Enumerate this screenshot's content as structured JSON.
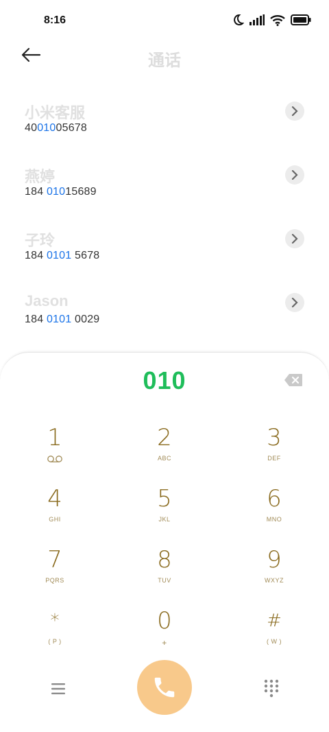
{
  "status_bar": {
    "time": "8:16",
    "icons": [
      "moon-icon",
      "signal-icon",
      "wifi-icon",
      "battery-icon"
    ]
  },
  "header": {
    "title": "通话",
    "back_icon": "arrow-left-icon"
  },
  "contacts": [
    {
      "name": "小米客服",
      "number_pre": "40",
      "number_match": "010",
      "number_post": "05678"
    },
    {
      "name": "燕婷",
      "number_pre": "184 ",
      "number_match": "010",
      "number_post": "15689"
    },
    {
      "name": "子玲",
      "number_pre": "184 ",
      "number_match": "0101",
      "number_post": " 5678"
    },
    {
      "name": "Jason",
      "number_pre": "184 ",
      "number_match": "0101",
      "number_post": " 0029"
    }
  ],
  "dialer": {
    "input": "010",
    "keys": [
      {
        "digit": "1",
        "letters": ""
      },
      {
        "digit": "2",
        "letters": "ABC"
      },
      {
        "digit": "3",
        "letters": "DEF"
      },
      {
        "digit": "4",
        "letters": "GHI"
      },
      {
        "digit": "5",
        "letters": "JKL"
      },
      {
        "digit": "6",
        "letters": "MNO"
      },
      {
        "digit": "7",
        "letters": "PQRS"
      },
      {
        "digit": "8",
        "letters": "TUV"
      },
      {
        "digit": "9",
        "letters": "WXYZ"
      },
      {
        "digit": "*",
        "letters": "( P )"
      },
      {
        "digit": "0",
        "letters": "+"
      },
      {
        "digit": "#",
        "letters": "( W )"
      }
    ]
  },
  "colors": {
    "highlight": "#1a73e8",
    "dial_input": "#1fbd5a",
    "key_text": "#8a6b1f",
    "call_button": "#f8c98b"
  }
}
